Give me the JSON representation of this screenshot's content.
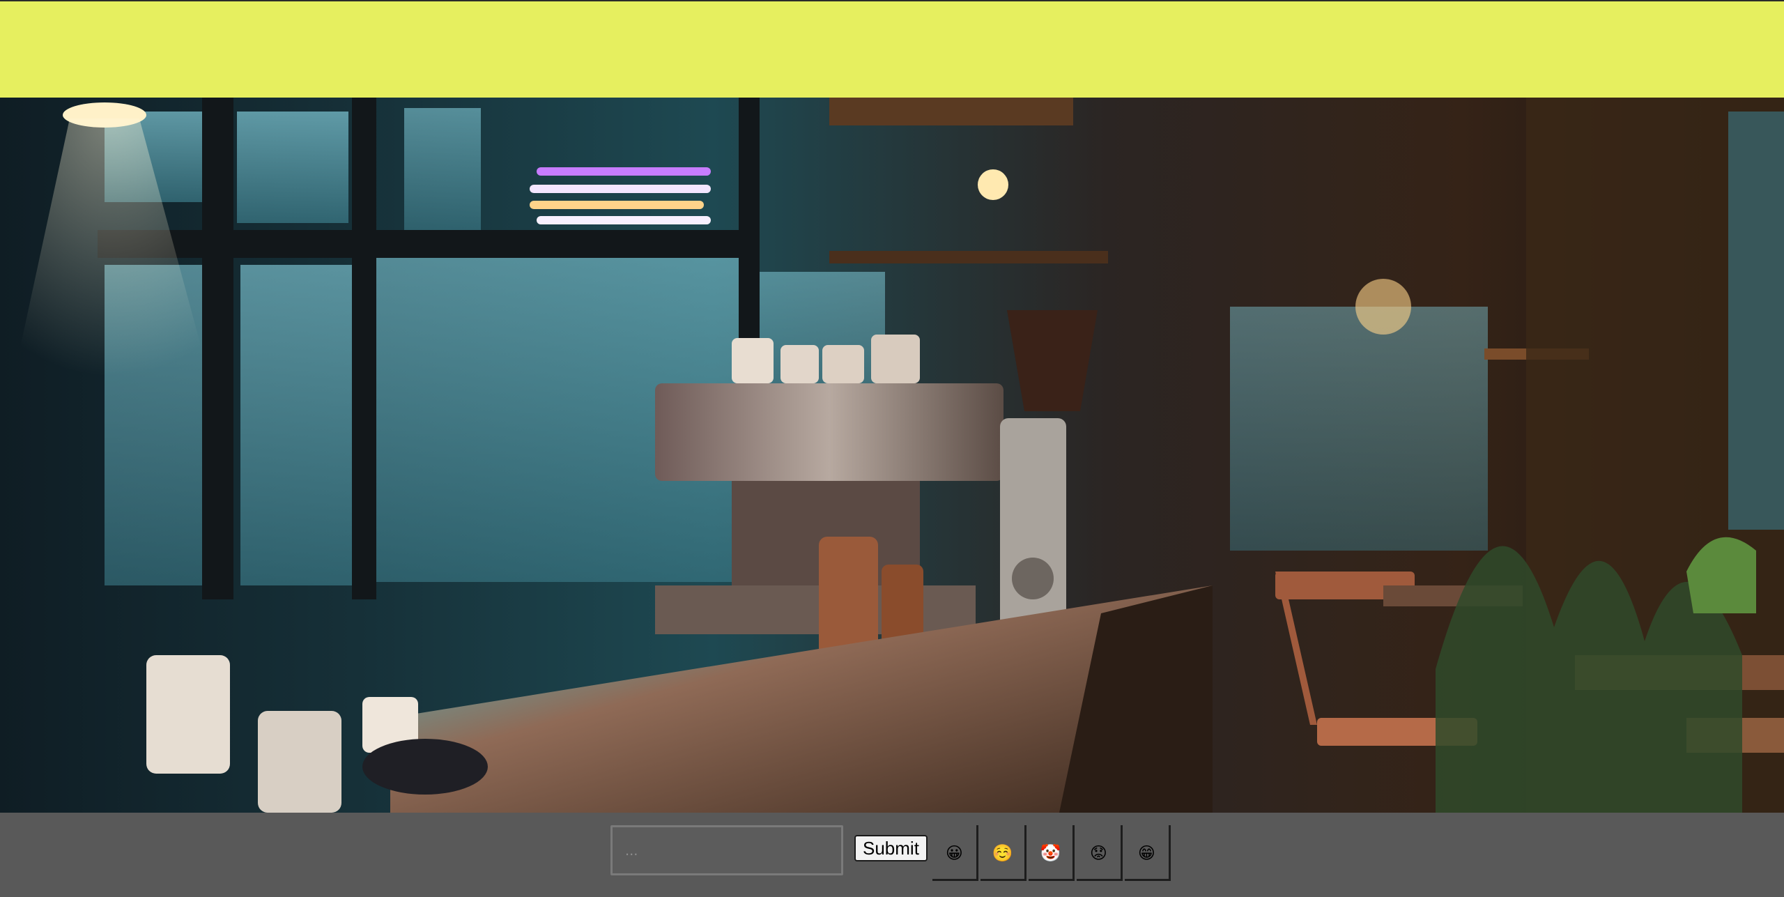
{
  "composer": {
    "placeholder": "...",
    "value": "",
    "submit_label": "Submit"
  },
  "reactions": [
    {
      "emoji": "😀",
      "name": "grinning-face"
    },
    {
      "emoji": "☺️",
      "name": "smiling-face"
    },
    {
      "emoji": "🤡",
      "name": "clown-face"
    },
    {
      "emoji": "😟",
      "name": "worried-face"
    },
    {
      "emoji": "😁",
      "name": "beaming-face"
    }
  ],
  "colors": {
    "top_band": "#e6ef5f",
    "bottom_bar": "#595959"
  }
}
